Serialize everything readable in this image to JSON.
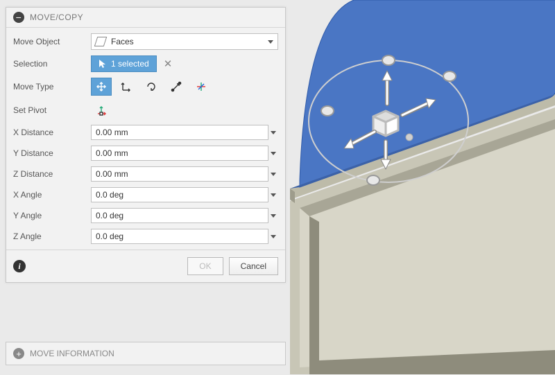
{
  "panel": {
    "title": "MOVE/COPY",
    "rows": {
      "move_object": {
        "label": "Move Object",
        "value": "Faces"
      },
      "selection": {
        "label": "Selection",
        "chip": "1 selected"
      },
      "move_type": {
        "label": "Move Type"
      },
      "set_pivot": {
        "label": "Set Pivot"
      },
      "x_dist": {
        "label": "X Distance",
        "value": "0.00 mm"
      },
      "y_dist": {
        "label": "Y Distance",
        "value": "0.00 mm"
      },
      "z_dist": {
        "label": "Z Distance",
        "value": "0.00 mm"
      },
      "x_ang": {
        "label": "X Angle",
        "value": "0.0 deg"
      },
      "y_ang": {
        "label": "Y Angle",
        "value": "0.0 deg"
      },
      "z_ang": {
        "label": "Z Angle",
        "value": "0.0 deg"
      }
    },
    "footer": {
      "ok": "OK",
      "cancel": "Cancel"
    }
  },
  "panel2": {
    "title": "MOVE INFORMATION"
  },
  "colors": {
    "face_selected": "#4a76c4",
    "part_body": "#b8b6a5",
    "accent": "#5ea2d8"
  }
}
